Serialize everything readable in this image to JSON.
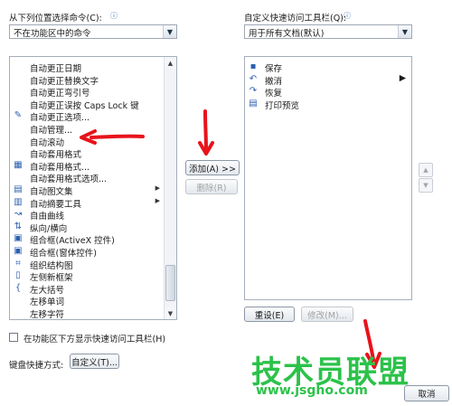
{
  "left": {
    "label": "从下列位置选择命令(C):",
    "combo_value": "不在功能区中的命令",
    "items": [
      {
        "icon": "",
        "label": "自动更正日期"
      },
      {
        "icon": "",
        "label": "自动更正替换文字"
      },
      {
        "icon": "",
        "label": "自动更正弯引号"
      },
      {
        "icon": "",
        "label": "自动更正误按 Caps Lock 键"
      },
      {
        "icon": "pencil-icon",
        "glyph": "✎",
        "label": "自动更正选项..."
      },
      {
        "icon": "",
        "label": "自动管理..."
      },
      {
        "icon": "",
        "label": "自动滚动"
      },
      {
        "icon": "",
        "label": "自动套用格式"
      },
      {
        "icon": "format-icon",
        "glyph": "▦",
        "label": "自动套用格式..."
      },
      {
        "icon": "",
        "label": "自动套用格式选项..."
      },
      {
        "icon": "gallery-icon",
        "glyph": "▤",
        "label": "自动图文集",
        "submenu": true
      },
      {
        "icon": "summary-icon",
        "glyph": "▥",
        "label": "自动摘要工具",
        "submenu": true
      },
      {
        "icon": "curve-icon",
        "glyph": "↝",
        "label": "自由曲线"
      },
      {
        "icon": "orientation-icon",
        "glyph": "⇅",
        "label": "纵向/横向"
      },
      {
        "icon": "combo-activex-icon",
        "glyph": "▣",
        "label": "组合框(ActiveX 控件)"
      },
      {
        "icon": "combo-form-icon",
        "glyph": "▣",
        "label": "组合框(窗体控件)"
      },
      {
        "icon": "org-chart-icon",
        "glyph": "⌗",
        "label": "组织结构图"
      },
      {
        "icon": "frame-icon",
        "glyph": "▯",
        "label": "左侧新框架"
      },
      {
        "icon": "brace-icon",
        "glyph": "{",
        "label": "左大括号"
      },
      {
        "icon": "",
        "label": "左移单词"
      },
      {
        "icon": "",
        "label": "左移字符"
      }
    ]
  },
  "right": {
    "label": "自定义快速访问工具栏(Q):",
    "combo_value": "用于所有文档(默认)",
    "items": [
      {
        "icon": "save-icon",
        "glyph": "▪",
        "label": "保存"
      },
      {
        "icon": "undo-icon",
        "glyph": "↶",
        "label": "撤消"
      },
      {
        "icon": "redo-icon",
        "glyph": "↷",
        "label": "恢复"
      },
      {
        "icon": "print-preview-icon",
        "glyph": "▤",
        "label": "打印预览"
      }
    ]
  },
  "buttons": {
    "add": "添加(A) >>",
    "remove": "删除(R)",
    "reset": "重设(E)",
    "modify": "修改(M)...",
    "customize": "自定义(T)...",
    "cancel": "取消"
  },
  "checkbox_label": "在功能区下方显示快速访问工具栏(H)",
  "shortcut_label": "键盘快捷方式:",
  "watermark": {
    "text": "技术员联盟",
    "url": "www.jsgho.com"
  },
  "colors": {
    "annotation": "#e8131b",
    "watermark": "#2cc24a"
  }
}
